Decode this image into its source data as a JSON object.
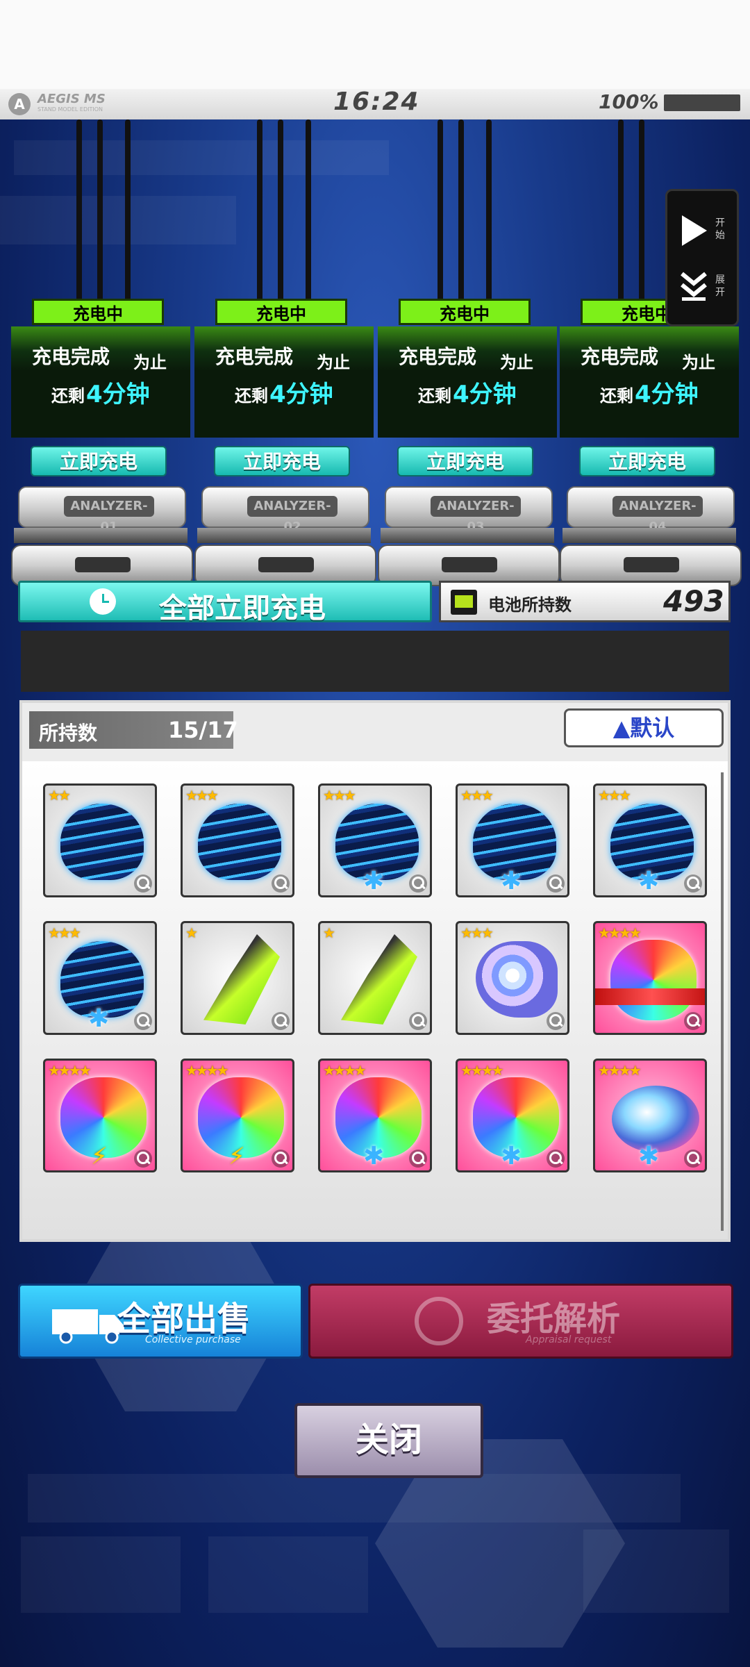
{
  "status_bar": {
    "logo_text": "AEGIS MS",
    "logo_subtext": "STAND MODEL EDITION",
    "time": "16:24",
    "battery": "100%"
  },
  "side_panel": {
    "start_label": "开始",
    "expand_label": "展开"
  },
  "analyzers": [
    {
      "status": "充电中",
      "done_label": "充电完成",
      "until": "为止",
      "remain_prefix": "还剩",
      "remain_value": "4分钟",
      "button": "立即充电",
      "plate": "ANALYZER-01"
    },
    {
      "status": "充电中",
      "done_label": "充电完成",
      "until": "为止",
      "remain_prefix": "还剩",
      "remain_value": "4分钟",
      "button": "立即充电",
      "plate": "ANALYZER-02"
    },
    {
      "status": "充电中",
      "done_label": "充电完成",
      "until": "为止",
      "remain_prefix": "还剩",
      "remain_value": "4分钟",
      "button": "立即充电",
      "plate": "ANALYZER-03"
    },
    {
      "status": "充电中",
      "done_label": "充电完成",
      "until": "为止",
      "remain_prefix": "还剩",
      "remain_value": "4分钟",
      "button": "立即充电",
      "plate": "ANALYZER-04"
    }
  ],
  "charge_all_label": "全部立即充电",
  "battery_stock": {
    "label": "电池所持数",
    "count": "493"
  },
  "inventory": {
    "held_label": "所持数",
    "held_count": "15/17",
    "sort_label": "▲默认",
    "items": [
      {
        "stars": "★★",
        "kind": "blue-clam",
        "badge": ""
      },
      {
        "stars": "★★★",
        "kind": "blue-clam",
        "badge": ""
      },
      {
        "stars": "★★★",
        "kind": "blue-clam",
        "badge": "snowflake"
      },
      {
        "stars": "★★★",
        "kind": "blue-clam",
        "badge": "snowflake"
      },
      {
        "stars": "★★★",
        "kind": "blue-clam",
        "badge": "snowflake"
      },
      {
        "stars": "★★★",
        "kind": "blue-clam",
        "badge": "snowflake"
      },
      {
        "stars": "★",
        "kind": "green-conch",
        "badge": ""
      },
      {
        "stars": "★",
        "kind": "green-conch",
        "badge": ""
      },
      {
        "stars": "★★★",
        "kind": "nautilus",
        "badge": ""
      },
      {
        "stars": "★★★★",
        "kind": "rainbow-ribbon",
        "badge": ""
      },
      {
        "stars": "★★★★",
        "kind": "rainbow-clam",
        "badge": "lightning"
      },
      {
        "stars": "★★★★",
        "kind": "rainbow-clam",
        "badge": "lightning"
      },
      {
        "stars": "★★★★",
        "kind": "rainbow-clam",
        "badge": "snowflake"
      },
      {
        "stars": "★★★★",
        "kind": "rainbow-clam",
        "badge": "snowflake"
      },
      {
        "stars": "★★★★",
        "kind": "abalone",
        "badge": "snowflake"
      }
    ]
  },
  "buttons": {
    "sell_all": "全部出售",
    "sell_all_sub": "Collective purchase",
    "appraisal": "委托解析",
    "appraisal_sub": "Appraisal request",
    "close": "关闭"
  },
  "colors": {
    "charging_tag": "#7df019",
    "remain_time": "#3ef5ff",
    "charge_button": "#17b9b0",
    "sell_button": "#1682d8",
    "appraisal_button": "#8a1a3e",
    "sort_text": "#2a46c8"
  }
}
